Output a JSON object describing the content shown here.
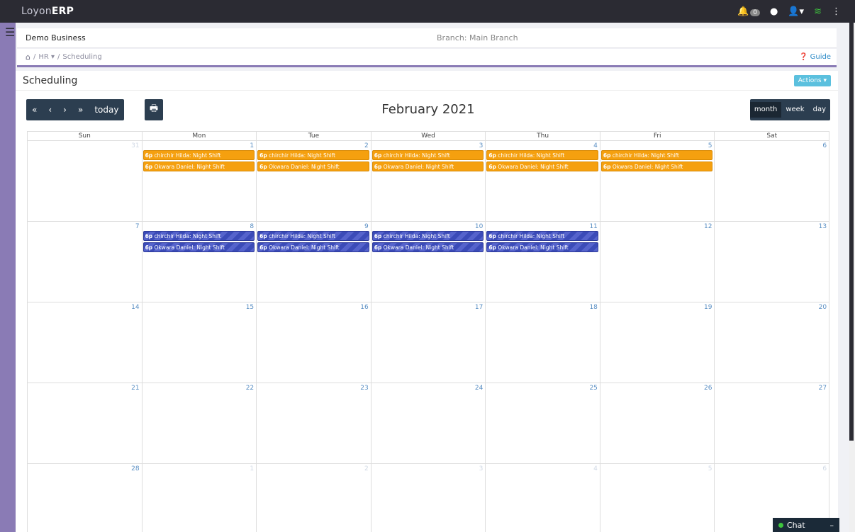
{
  "app": {
    "brand_part1": "Loyon",
    "brand_part2": "ERP"
  },
  "topbar": {
    "notifications_count": "0"
  },
  "business": {
    "name": "Demo Business",
    "branch": "Branch: Main Branch"
  },
  "breadcrumb": {
    "hr": "HR ▾",
    "separator": "/",
    "current": "Scheduling",
    "guide": "Guide"
  },
  "panel": {
    "title": "Scheduling",
    "actions": "Actions ▾"
  },
  "calendar": {
    "title": "February 2021",
    "nav": {
      "prev_year": "«",
      "prev": "‹",
      "next": "›",
      "next_year": "»",
      "today": "today"
    },
    "views": {
      "month": "month",
      "week": "week",
      "day": "day"
    },
    "weekdays": [
      "Sun",
      "Mon",
      "Tue",
      "Wed",
      "Thu",
      "Fri",
      "Sat"
    ],
    "weeks": [
      [
        {
          "n": "31",
          "other": true,
          "events": []
        },
        {
          "n": "1",
          "events": [
            {
              "t": "6p",
              "s": "chirchir Hilda: Night Shift",
              "c": "orange"
            },
            {
              "t": "6p",
              "s": "Okwara Daniel: Night Shift",
              "c": "orange"
            }
          ]
        },
        {
          "n": "2",
          "events": [
            {
              "t": "6p",
              "s": "chirchir Hilda: Night Shift",
              "c": "orange"
            },
            {
              "t": "6p",
              "s": "Okwara Daniel: Night Shift",
              "c": "orange"
            }
          ]
        },
        {
          "n": "3",
          "events": [
            {
              "t": "6p",
              "s": "chirchir Hilda: Night Shift",
              "c": "orange"
            },
            {
              "t": "6p",
              "s": "Okwara Daniel: Night Shift",
              "c": "orange"
            }
          ]
        },
        {
          "n": "4",
          "events": [
            {
              "t": "6p",
              "s": "chirchir Hilda: Night Shift",
              "c": "orange"
            },
            {
              "t": "6p",
              "s": "Okwara Daniel: Night Shift",
              "c": "orange"
            }
          ]
        },
        {
          "n": "5",
          "events": [
            {
              "t": "6p",
              "s": "chirchir Hilda: Night Shift",
              "c": "orange"
            },
            {
              "t": "6p",
              "s": "Okwara Daniel: Night Shift",
              "c": "orange"
            }
          ]
        },
        {
          "n": "6",
          "events": []
        }
      ],
      [
        {
          "n": "7",
          "events": []
        },
        {
          "n": "8",
          "events": [
            {
              "t": "6p",
              "s": "chirchir Hilda: Night Shift",
              "c": "blue"
            },
            {
              "t": "6p",
              "s": "Okwara Daniel: Night Shift",
              "c": "blue"
            }
          ]
        },
        {
          "n": "9",
          "events": [
            {
              "t": "6p",
              "s": "chirchir Hilda: Night Shift",
              "c": "blue"
            },
            {
              "t": "6p",
              "s": "Okwara Daniel: Night Shift",
              "c": "blue"
            }
          ]
        },
        {
          "n": "10",
          "events": [
            {
              "t": "6p",
              "s": "chirchir Hilda: Night Shift",
              "c": "blue"
            },
            {
              "t": "6p",
              "s": "Okwara Daniel: Night Shift",
              "c": "blue"
            }
          ]
        },
        {
          "n": "11",
          "events": [
            {
              "t": "6p",
              "s": "chirchir Hilda: Night Shift",
              "c": "blue"
            },
            {
              "t": "6p",
              "s": "Okwara Daniel: Night Shift",
              "c": "blue"
            }
          ]
        },
        {
          "n": "12",
          "events": []
        },
        {
          "n": "13",
          "events": []
        }
      ],
      [
        {
          "n": "14",
          "events": []
        },
        {
          "n": "15",
          "events": []
        },
        {
          "n": "16",
          "events": []
        },
        {
          "n": "17",
          "events": []
        },
        {
          "n": "18",
          "events": []
        },
        {
          "n": "19",
          "events": []
        },
        {
          "n": "20",
          "events": []
        }
      ],
      [
        {
          "n": "21",
          "events": []
        },
        {
          "n": "22",
          "events": []
        },
        {
          "n": "23",
          "events": []
        },
        {
          "n": "24",
          "events": []
        },
        {
          "n": "25",
          "events": []
        },
        {
          "n": "26",
          "events": []
        },
        {
          "n": "27",
          "events": []
        }
      ],
      [
        {
          "n": "28",
          "events": []
        },
        {
          "n": "1",
          "other": true,
          "events": []
        },
        {
          "n": "2",
          "other": true,
          "events": []
        },
        {
          "n": "3",
          "other": true,
          "events": []
        },
        {
          "n": "4",
          "other": true,
          "events": []
        },
        {
          "n": "5",
          "other": true,
          "events": []
        },
        {
          "n": "6",
          "other": true,
          "events": []
        }
      ]
    ]
  },
  "chat": {
    "label": "Chat",
    "minimize": "–"
  },
  "colors": {
    "topbar": "#2b2b33",
    "sidebar": "#8a7bb5",
    "toolbar": "#2c3e50",
    "event_orange": "#f5a00f",
    "event_blue": "#3b4bb8",
    "link": "#2f8cc8"
  }
}
